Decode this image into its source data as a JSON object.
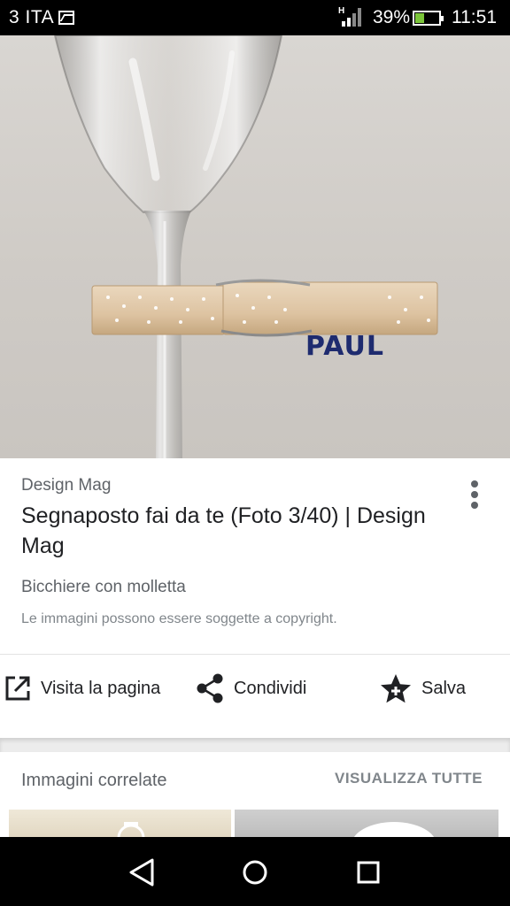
{
  "status_bar": {
    "carrier": "3 ITA",
    "network": "H",
    "battery_percent": "39%",
    "battery_level": 0.39,
    "time": "11:51",
    "icons": [
      "image-notification-icon",
      "signal-icon",
      "battery-icon"
    ]
  },
  "hero": {
    "clothespin_text": "PAUL"
  },
  "result": {
    "source": "Design Mag",
    "title": "Segnaposto fai da te (Foto 3/40) | Design Mag",
    "subtitle": "Bicchiere con molletta",
    "copyright_notice": "Le immagini possono essere soggette a copyright."
  },
  "actions": {
    "visit_label": "Visita la pagina",
    "share_label": "Condividi",
    "save_label": "Salva",
    "icons": [
      "open-external-icon",
      "share-icon",
      "save-star-icon",
      "more-vert-icon"
    ]
  },
  "related": {
    "title": "Immagini correlate",
    "view_all_label": "VISUALIZZA TUTTE"
  },
  "nav_bar": {
    "icons": [
      "back-icon",
      "home-icon",
      "recent-apps-icon"
    ]
  },
  "colors": {
    "text_primary": "#202124",
    "text_secondary": "#5f6368",
    "ink_label": "#1e2b6f",
    "battery_fill": "#7cc63a"
  }
}
